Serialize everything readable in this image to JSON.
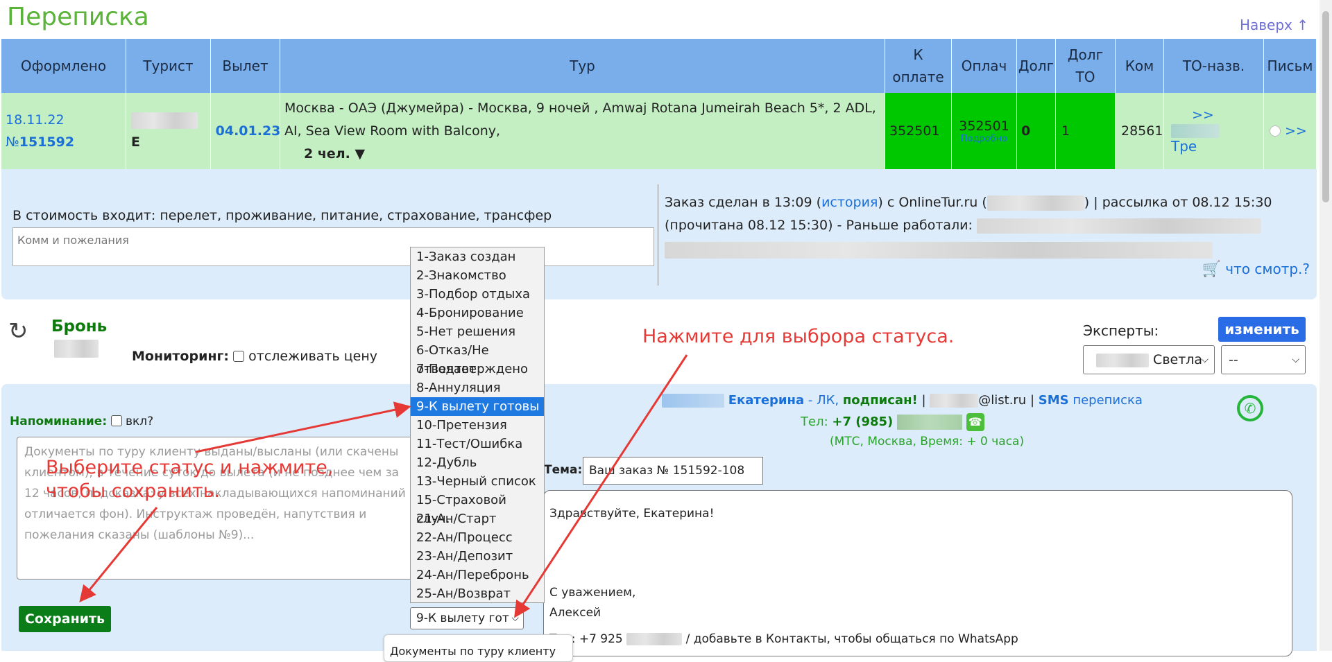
{
  "page": {
    "title": "Переписка",
    "top_link": "Наверх ↑"
  },
  "table": {
    "headers": [
      "Оформлено",
      "Турист",
      "Вылет",
      "Тур",
      "К оплате",
      "Оплач",
      "Долг",
      "Долг ТО",
      "Ком",
      "ТО-назв.",
      "Письм"
    ],
    "row": {
      "date": "18.11.22",
      "number_prefix": "№",
      "number": "151592",
      "tourist_initial": "Е",
      "departure": "04.01.23",
      "tour": "Москва - ОАЭ (Джумейра) - Москва, 9 ночей , Amwaj Rotana Jumeirah Beach 5*, 2 ADL, AI, Sea View Room with Balcony,",
      "people": "2 чел.",
      "to_pay": "352501",
      "paid": "352501",
      "paid_details": "Подробно",
      "debt": "0",
      "debt_to": "1",
      "commission": "28561",
      "to_arrows": ">>",
      "to_name": "Тре",
      "letters_arrows": ">>"
    }
  },
  "info": {
    "includes": "В стоимость входит: перелет, проживание, питание, страхование, трансфер",
    "comments_placeholder": "Комм и пожелания",
    "order_line1_a": "Заказ сделан в 13:09 (",
    "history_link": "история",
    "order_line1_b": ") с OnlineTur.ru (",
    "order_line1_c": ") | рассылка от 08.12 15:30",
    "order_line2": "(прочитана 08.12 15:30) - Раньше работали:",
    "watched_link": "что смотр.?"
  },
  "status_options": [
    "1-Заказ создан",
    "2-Знакомство",
    "3-Подбор отдыха",
    "4-Бронирование",
    "5-Нет решения",
    "6-Отказ/Не отвечает",
    "7-Подтверждено",
    "8-Аннуляция",
    "9-К вылету готовы",
    "10-Претензия",
    "11-Тест/Ошибка",
    "12-Дубль",
    "13-Черный список",
    "15-Страховой случ.",
    "21-Ан/Старт",
    "22-Ан/Процесс",
    "23-Ан/Депозит",
    "24-Ан/Перебронь",
    "25-Ан/Возврат"
  ],
  "status_selected_index": 8,
  "status_select_value": "9-К вылету гот",
  "booking": {
    "title": "Бронь",
    "monitoring_label": "Мониторинг:",
    "monitoring_option": "отслеживать цену"
  },
  "experts": {
    "label": "Эксперты:",
    "change_button": "изменить",
    "expert1": "Светла",
    "expert2": "--"
  },
  "reminder": {
    "label": "Напоминание:",
    "toggle": "вкл?",
    "text": "Документы по туру клиенту выданы/высланы (или скачены клиентом), в течение суток до вылета (и не позднее чем за 12 часов, подсказка: у всех накладывающихся напоминаний отличается фон). Инструктаж проведён, напутствия и пожелания сказаны (шаблоны №9)...",
    "save_button": "Сохранить"
  },
  "client": {
    "name": "Екатерина",
    "lk": "ЛК",
    "signed": "подписан!",
    "email_domain": "@list.ru",
    "sms": "SMS",
    "correspondence": "переписка",
    "phone_label": "Тел:",
    "phone": "+7 (985)",
    "operator": "(МТС, Москва, Время: + 0 часа)"
  },
  "message": {
    "subject_label": "Тема:",
    "subject": "Ваш заказ № 151592-108",
    "greeting": "Здравствуйте, Екатерина!",
    "regards": "С уважением,",
    "signature": "Алексей",
    "footer": "Тел: +7 925",
    "footer_tail": "/ добавьте в Контакты, чтобы общаться по WhatsApp"
  },
  "doc_popup": "Документы по туру клиенту выданы",
  "annotations": {
    "press_status": "Нажмите для выброра статуса.",
    "choose_status_1": "Выберите статус и нажмите,",
    "choose_status_2": "чтобы сохранить."
  },
  "colors": {
    "header_bg": "#7aaeea",
    "row_bg": "#c3efc3",
    "paid_bg": "#00c800",
    "panel_bg": "#ddecfa",
    "save_bg": "#0a7d19",
    "annotation": "#e53935"
  }
}
